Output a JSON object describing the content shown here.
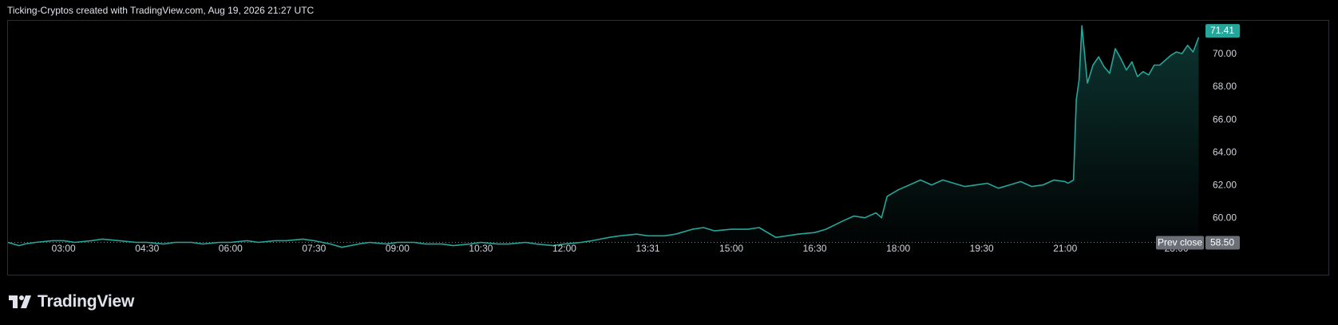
{
  "header": {
    "attribution": "Ticking-Cryptos created with TradingView.com, Aug 19, 2026 21:27 UTC"
  },
  "brand": {
    "name": "TradingView",
    "icon": "tradingview-logo-icon"
  },
  "colors": {
    "line": "#26a69a",
    "last_price_tag": "#26a69a",
    "prev_close_tag": "#6b6f78",
    "background": "#000000",
    "border": "#2a2e39"
  },
  "chart_data": {
    "type": "area",
    "xlabel": "",
    "ylabel": "",
    "x_ticks": [
      "03:00",
      "04:30",
      "06:00",
      "07:30",
      "09:00",
      "10:30",
      "12:00",
      "13:31",
      "15:00",
      "16:30",
      "18:00",
      "19:30",
      "21:00",
      "23:00"
    ],
    "x_tick_hours": [
      3.0,
      4.5,
      6.0,
      7.5,
      9.0,
      10.5,
      12.0,
      13.5,
      15.0,
      16.5,
      18.0,
      19.5,
      21.0,
      23.0
    ],
    "y_ticks": [
      "60.00",
      "62.00",
      "64.00",
      "66.00",
      "68.00",
      "70.00"
    ],
    "y_tick_values": [
      60,
      62,
      64,
      66,
      68,
      70
    ],
    "ylim": [
      57.6,
      72.0
    ],
    "xlim_hours": [
      2.0,
      23.45
    ],
    "grid": false,
    "last_price": 71.41,
    "last_price_label": "71.41",
    "prev_close": 58.5,
    "prev_close_label": "58.50",
    "prev_close_text": "Prev close",
    "series": [
      {
        "x_hours": [
          2.0,
          2.1,
          2.2,
          2.3,
          2.5,
          2.8,
          3.0,
          3.2,
          3.5,
          3.7,
          4.0,
          4.3,
          4.5,
          4.8,
          5.0,
          5.3,
          5.5,
          5.8,
          6.0,
          6.3,
          6.5,
          6.8,
          7.0,
          7.3,
          7.5,
          7.8,
          8.0,
          8.3,
          8.5,
          8.8,
          9.0,
          9.3,
          9.5,
          9.8,
          10.0,
          10.3,
          10.5,
          10.8,
          11.0,
          11.3,
          11.5,
          11.8,
          12.0,
          12.3,
          12.5,
          12.8,
          13.0,
          13.3,
          13.5,
          13.8,
          14.0,
          14.3,
          14.5,
          14.7,
          15.0,
          15.3,
          15.5,
          15.8,
          16.0,
          16.2,
          16.5,
          16.7,
          17.0,
          17.2,
          17.4,
          17.6,
          17.7,
          17.8,
          18.0,
          18.2,
          18.4,
          18.6,
          18.8,
          19.0,
          19.2,
          19.4,
          19.6,
          19.8,
          20.0,
          20.2,
          20.4,
          20.6,
          20.8,
          21.0,
          21.05,
          21.1,
          21.15,
          21.2,
          21.25,
          21.3,
          21.4,
          21.5,
          21.6,
          21.7,
          21.8,
          21.9,
          22.0,
          22.1,
          22.2,
          22.3,
          22.4,
          22.5,
          22.6,
          22.7,
          22.8,
          22.9,
          23.0,
          23.1,
          23.2,
          23.3,
          23.4
        ],
        "values": [
          58.5,
          58.4,
          58.3,
          58.4,
          58.5,
          58.6,
          58.6,
          58.5,
          58.6,
          58.7,
          58.6,
          58.5,
          58.5,
          58.4,
          58.5,
          58.5,
          58.4,
          58.5,
          58.5,
          58.6,
          58.5,
          58.6,
          58.6,
          58.7,
          58.6,
          58.4,
          58.2,
          58.4,
          58.5,
          58.4,
          58.5,
          58.5,
          58.4,
          58.4,
          58.3,
          58.4,
          58.5,
          58.4,
          58.4,
          58.5,
          58.4,
          58.3,
          58.4,
          58.5,
          58.6,
          58.8,
          58.9,
          59.0,
          58.9,
          58.9,
          59.0,
          59.3,
          59.4,
          59.2,
          59.3,
          59.3,
          59.4,
          58.8,
          58.9,
          59.0,
          59.1,
          59.3,
          59.8,
          60.1,
          60.0,
          60.3,
          60.0,
          61.3,
          61.7,
          62.0,
          62.3,
          62.0,
          62.3,
          62.1,
          61.9,
          62.0,
          62.1,
          61.8,
          62.0,
          62.2,
          61.9,
          62.0,
          62.3,
          62.2,
          62.1,
          62.2,
          62.3,
          67.2,
          68.4,
          71.7,
          68.2,
          69.3,
          69.8,
          69.2,
          68.8,
          70.3,
          69.7,
          69.0,
          69.5,
          68.6,
          68.9,
          68.7,
          69.3,
          69.3,
          69.6,
          69.9,
          70.1,
          70.0,
          70.5,
          70.1,
          71.0,
          70.0,
          71.41
        ]
      }
    ]
  }
}
